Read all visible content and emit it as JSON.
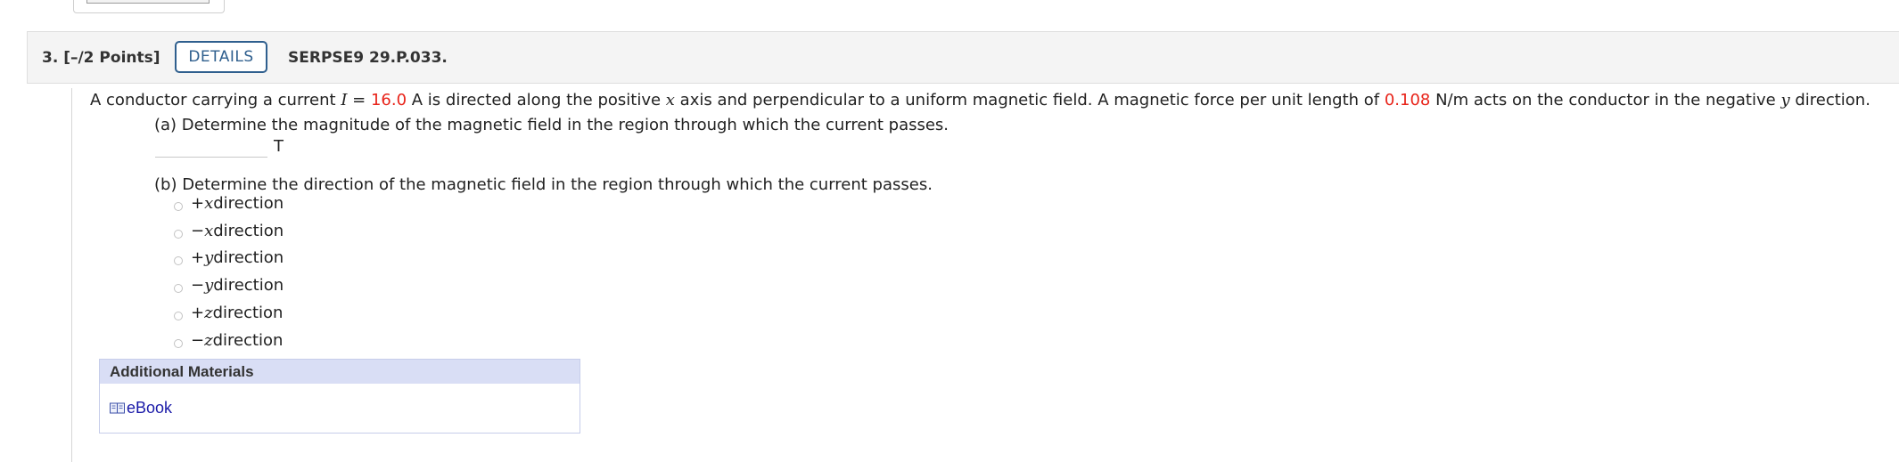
{
  "question": {
    "number_label": "3.  [–/2 Points]",
    "details_label": "DETAILS",
    "code": "SERPSE9 29.P.033."
  },
  "problem": {
    "t1": "A conductor carrying a current ",
    "var_I": "I",
    "t2": " = ",
    "current_value": "16.0",
    "t3": " A is directed along the positive ",
    "var_x": "x",
    "t4": " axis and perpendicular to a uniform magnetic field. A magnetic force per unit length of ",
    "force_value": "0.108",
    "t5": " N/m acts on the conductor in the negative ",
    "var_y": "y",
    "t6": " direction."
  },
  "part_a": {
    "label": "(a) Determine the magnitude of the magnetic field in the region through which the current passes.",
    "input_value": "",
    "unit": "T"
  },
  "part_b": {
    "label": "(b) Determine the direction of the magnetic field in the region through which the current passes.",
    "options": [
      {
        "sign": "+",
        "axis": "x",
        "rest": " direction"
      },
      {
        "sign": "−",
        "axis": "x",
        "rest": " direction"
      },
      {
        "sign": "+",
        "axis": "y",
        "rest": " direction"
      },
      {
        "sign": "−",
        "axis": "y",
        "rest": " direction"
      },
      {
        "sign": "+",
        "axis": "z",
        "rest": " direction"
      },
      {
        "sign": "−",
        "axis": "z",
        "rest": " direction"
      }
    ]
  },
  "additional_materials": {
    "title": "Additional Materials",
    "link_label": "eBook",
    "icon": "book-icon"
  },
  "colors": {
    "accent_blue": "#2f5f8e",
    "highlight_red": "#e8241a",
    "link_blue": "#1a1aa8"
  }
}
